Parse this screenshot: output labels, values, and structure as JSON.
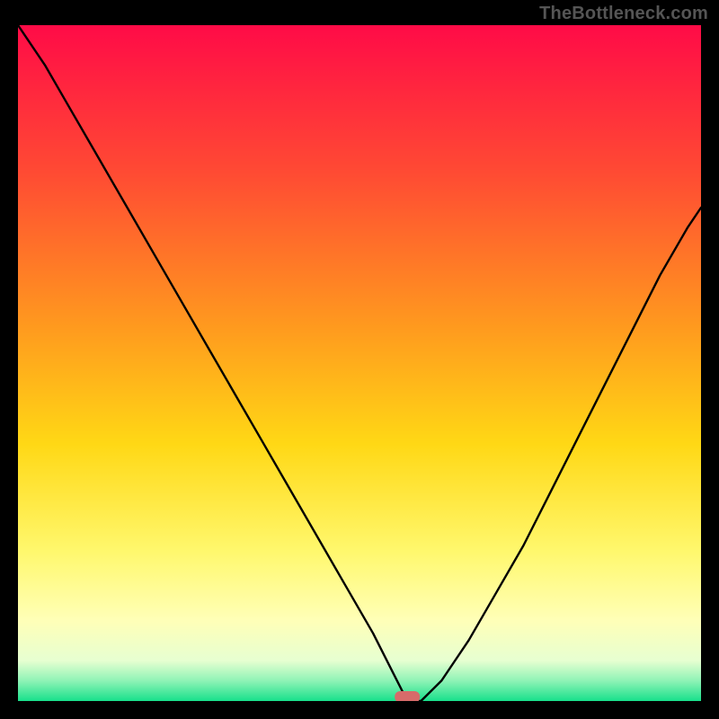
{
  "watermark": "TheBottleneck.com",
  "chart_data": {
    "type": "line",
    "title": "",
    "xlabel": "",
    "ylabel": "",
    "xlim": [
      0,
      100
    ],
    "ylim": [
      0,
      100
    ],
    "bottleneck_x": 57,
    "series": [
      {
        "name": "curve",
        "x": [
          0,
          4,
          8,
          12,
          16,
          20,
          24,
          28,
          32,
          36,
          40,
          44,
          48,
          52,
          55,
          57,
          59,
          62,
          66,
          70,
          74,
          78,
          82,
          86,
          90,
          94,
          98,
          100
        ],
        "y": [
          100,
          94,
          87,
          80,
          73,
          66,
          59,
          52,
          45,
          38,
          31,
          24,
          17,
          10,
          4,
          0,
          0,
          3,
          9,
          16,
          23,
          31,
          39,
          47,
          55,
          63,
          70,
          73
        ]
      }
    ],
    "marker": {
      "x": 57,
      "y": 0,
      "label": "bottleneck-point"
    },
    "gradient_stops": [
      {
        "offset": 0.0,
        "color": "#ff0b47"
      },
      {
        "offset": 0.22,
        "color": "#ff4b33"
      },
      {
        "offset": 0.45,
        "color": "#ff9b1e"
      },
      {
        "offset": 0.62,
        "color": "#ffd815"
      },
      {
        "offset": 0.78,
        "color": "#fff86e"
      },
      {
        "offset": 0.88,
        "color": "#ffffb7"
      },
      {
        "offset": 0.94,
        "color": "#e7ffd1"
      },
      {
        "offset": 0.97,
        "color": "#8ff3b6"
      },
      {
        "offset": 1.0,
        "color": "#18e08b"
      }
    ]
  }
}
